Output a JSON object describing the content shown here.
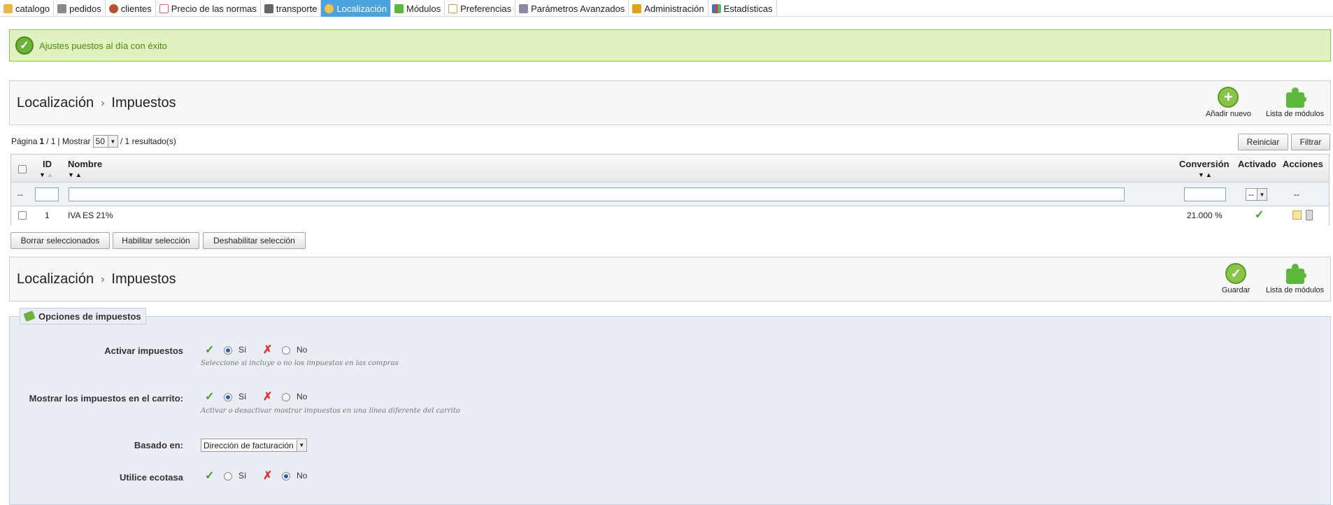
{
  "nav": {
    "tabs": [
      {
        "label": "catalogo",
        "icon": "folder-icon",
        "color": "#e8b64a",
        "active": false
      },
      {
        "label": "pedidos",
        "icon": "cart-icon",
        "color": "#8a8a8a",
        "active": false
      },
      {
        "label": "clientes",
        "icon": "user-icon",
        "color": "#b5542e",
        "active": false
      },
      {
        "label": "Precio de las normas",
        "icon": "price-rules-icon",
        "color": "#c66",
        "active": false
      },
      {
        "label": "transporte",
        "icon": "truck-icon",
        "color": "#666",
        "active": false
      },
      {
        "label": "Localización",
        "icon": "globe-icon",
        "color": "#f3c24a",
        "active": true
      },
      {
        "label": "Módulos",
        "icon": "puzzle-icon",
        "color": "#5cb83a",
        "active": false
      },
      {
        "label": "Preferencias",
        "icon": "preferences-icon",
        "color": "#c9a050",
        "active": false
      },
      {
        "label": "Parámetros Avanzados",
        "icon": "wrench-icon",
        "color": "#8a8aa8",
        "active": false
      },
      {
        "label": "Administración",
        "icon": "key-icon",
        "color": "#e0a020",
        "active": false
      },
      {
        "label": "Estadísticas",
        "icon": "bar-chart-icon",
        "color": "#4a6fc0",
        "active": false
      }
    ]
  },
  "message": {
    "text": "Ajustes puestos al día con éxito"
  },
  "toolbar1": {
    "crumb1": "Localización",
    "crumb2": "Impuestos",
    "add_label": "Añadir nuevo",
    "modules_label": "Lista de módulos"
  },
  "pager": {
    "prefix": "Página",
    "current": "1",
    "slash_total": "/ 1",
    "mostrar": "| Mostrar",
    "per_page": "50",
    "results": "/ 1 resultado(s)"
  },
  "buttons": {
    "reset": "Reiniciar",
    "filter": "Filtrar"
  },
  "table": {
    "columns": {
      "id": "ID",
      "name": "Nombre",
      "conversion": "Conversión",
      "enabled": "Activado",
      "actions": "Acciones"
    },
    "filter": {
      "placeholder_dash": "--",
      "enabled_select": "--",
      "actions_dash": "--"
    },
    "rows": [
      {
        "id": "1",
        "name": "IVA ES 21%",
        "conversion": "21.000 %",
        "enabled": true
      }
    ]
  },
  "bulk": {
    "delete": "Borrar seleccionados",
    "enable": "Habilitar selección",
    "disable": "Deshabilitar selección"
  },
  "toolbar2": {
    "crumb1": "Localización",
    "crumb2": "Impuestos",
    "save_label": "Guardar",
    "modules_label": "Lista de módulos"
  },
  "options": {
    "legend": "Opciones de impuestos",
    "yes": "Sí",
    "no": "No",
    "fields": [
      {
        "label": "Activar impuestos",
        "value": "yes",
        "hint": "Seleccione si incluye o no los impuestos en las compras"
      },
      {
        "label": "Mostrar los impuestos en el carrito:",
        "value": "yes",
        "hint": "Activar o desactivar mostrar impuestos en una línea diferente del carrito"
      },
      {
        "label": "Basado en:",
        "select": "Dirección de facturación"
      },
      {
        "label": "Utilice ecotasa",
        "value": "no"
      }
    ]
  }
}
